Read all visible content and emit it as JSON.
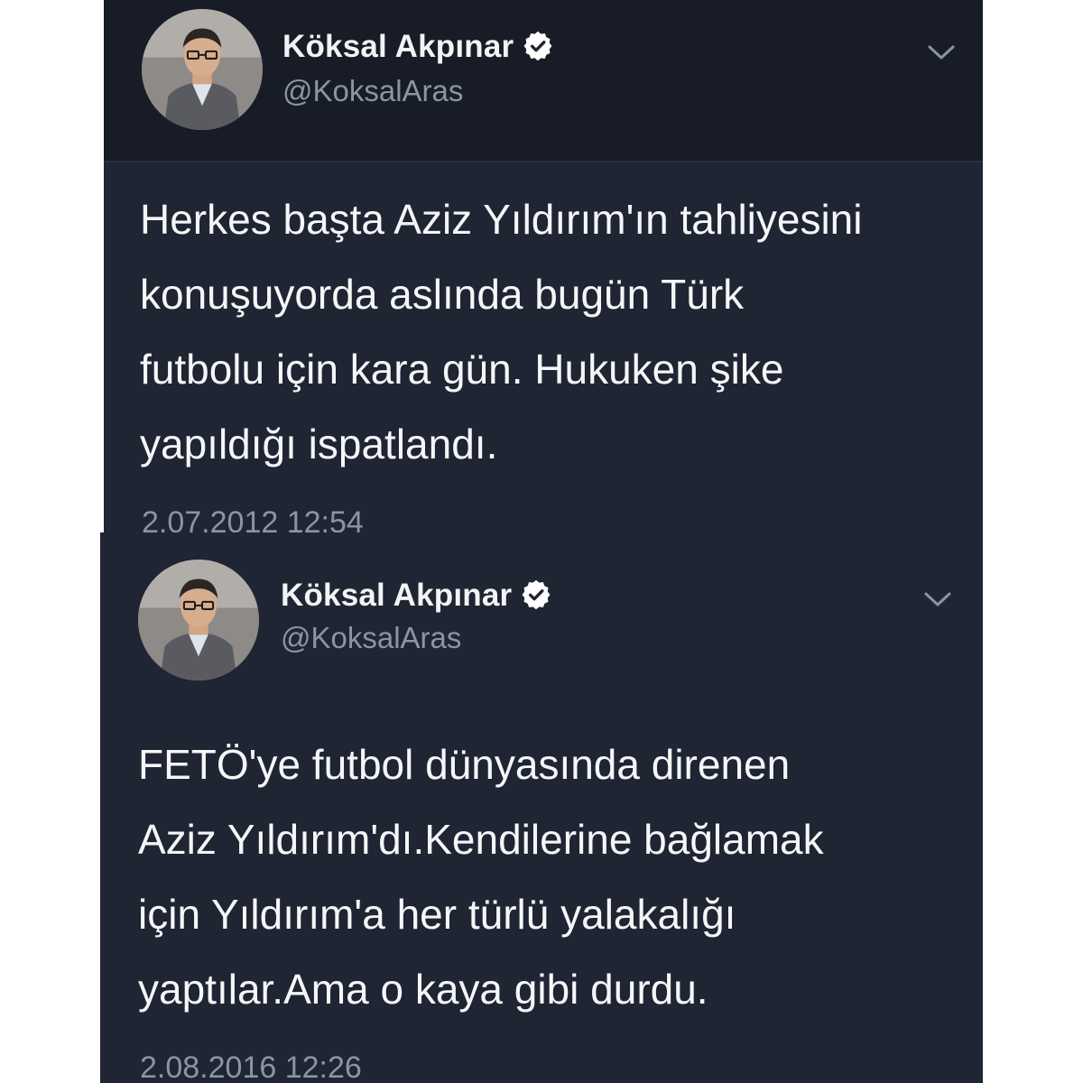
{
  "colors": {
    "panel_background": "#1f2532",
    "header_background": "#181c26",
    "name_text": "#f2f3f5",
    "secondary_text": "#8a95a3",
    "verified_badge": "#ffffff"
  },
  "tweets": [
    {
      "user": {
        "name": "Köksal Akpınar",
        "handle": "@KoksalAras",
        "verified_icon": "verified-badge-icon"
      },
      "menu_icon": "chevron-down-icon",
      "lines": [
        "Herkes başta Aziz Yıldırım'ın tahliyesini",
        "konuşuyorda aslında bugün Türk",
        "futbolu için kara gün. Hukuken şike",
        "yapıldığı ispatlandı."
      ],
      "timestamp": "2.07.2012 12:54"
    },
    {
      "user": {
        "name": "Köksal Akpınar",
        "handle": "@KoksalAras",
        "verified_icon": "verified-badge-icon"
      },
      "menu_icon": "chevron-down-icon",
      "lines": [
        "FETÖ'ye futbol dünyasında direnen",
        "Aziz Yıldırım'dı.Kendilerine bağlamak",
        "için Yıldırım'a her türlü yalakalığı",
        "yaptılar.Ama o kaya gibi durdu."
      ],
      "timestamp": "2.08.2016 12:26"
    }
  ]
}
